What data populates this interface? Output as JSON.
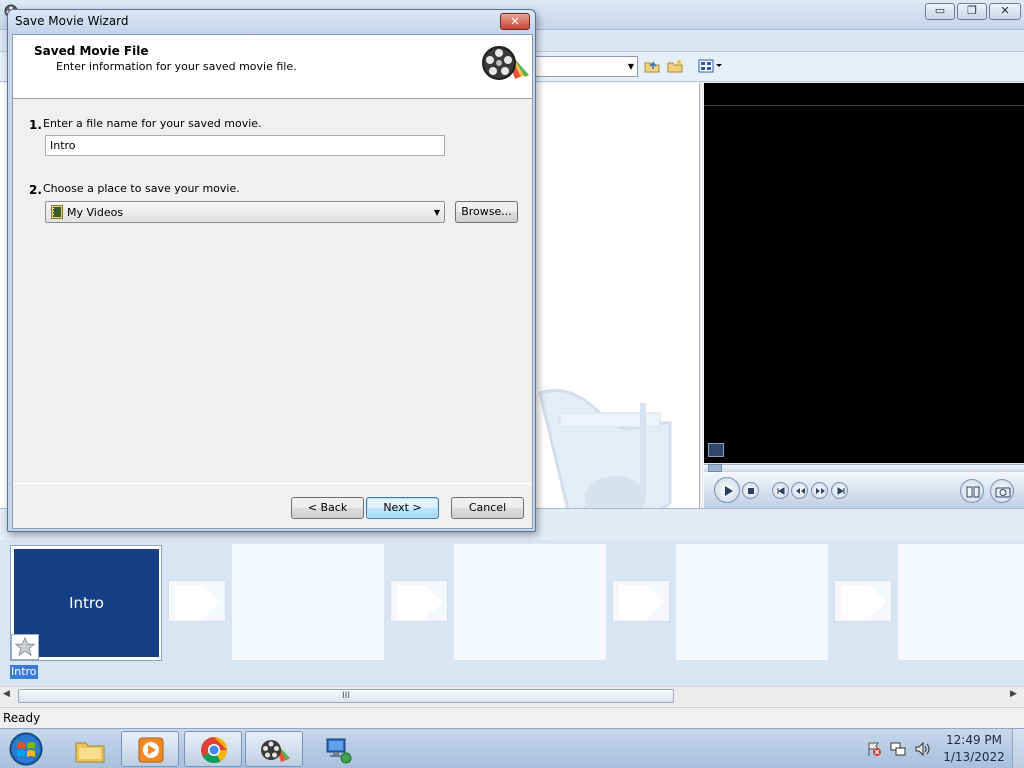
{
  "dialog": {
    "title": "Save Movie Wizard",
    "close_label": "✕",
    "header_title": "Saved Movie File",
    "header_subtitle": "Enter information for your saved movie file.",
    "step1_number": "1.",
    "step1_label": "Enter a file name for your saved movie.",
    "filename_value": "Intro",
    "step2_number": "2.",
    "step2_label": "Choose a place to save your movie.",
    "location_value": "My Videos",
    "browse_label": "Browse...",
    "back_label": "< Back",
    "next_label": "Next >",
    "cancel_label": "Cancel"
  },
  "main_window": {
    "minimize_label": "▭",
    "maximize_label": "❐",
    "close_label": "✕"
  },
  "storyboard": {
    "clip_title": "Intro",
    "clip_caption": "Intro",
    "scroll_grip": "III"
  },
  "status": {
    "text": "Ready"
  },
  "taskbar": {
    "apps": [
      "windows-explorer",
      "windows-media-player",
      "google-chrome",
      "windows-movie-maker",
      "network"
    ],
    "clock_time": "12:49 PM",
    "clock_date": "1/13/2022"
  },
  "colors": {
    "clip_thumb": "#143f84",
    "preview_screen": "#000000",
    "storyboard_bg": "#d9e5f2",
    "taskbar": "#b6cbe4"
  }
}
